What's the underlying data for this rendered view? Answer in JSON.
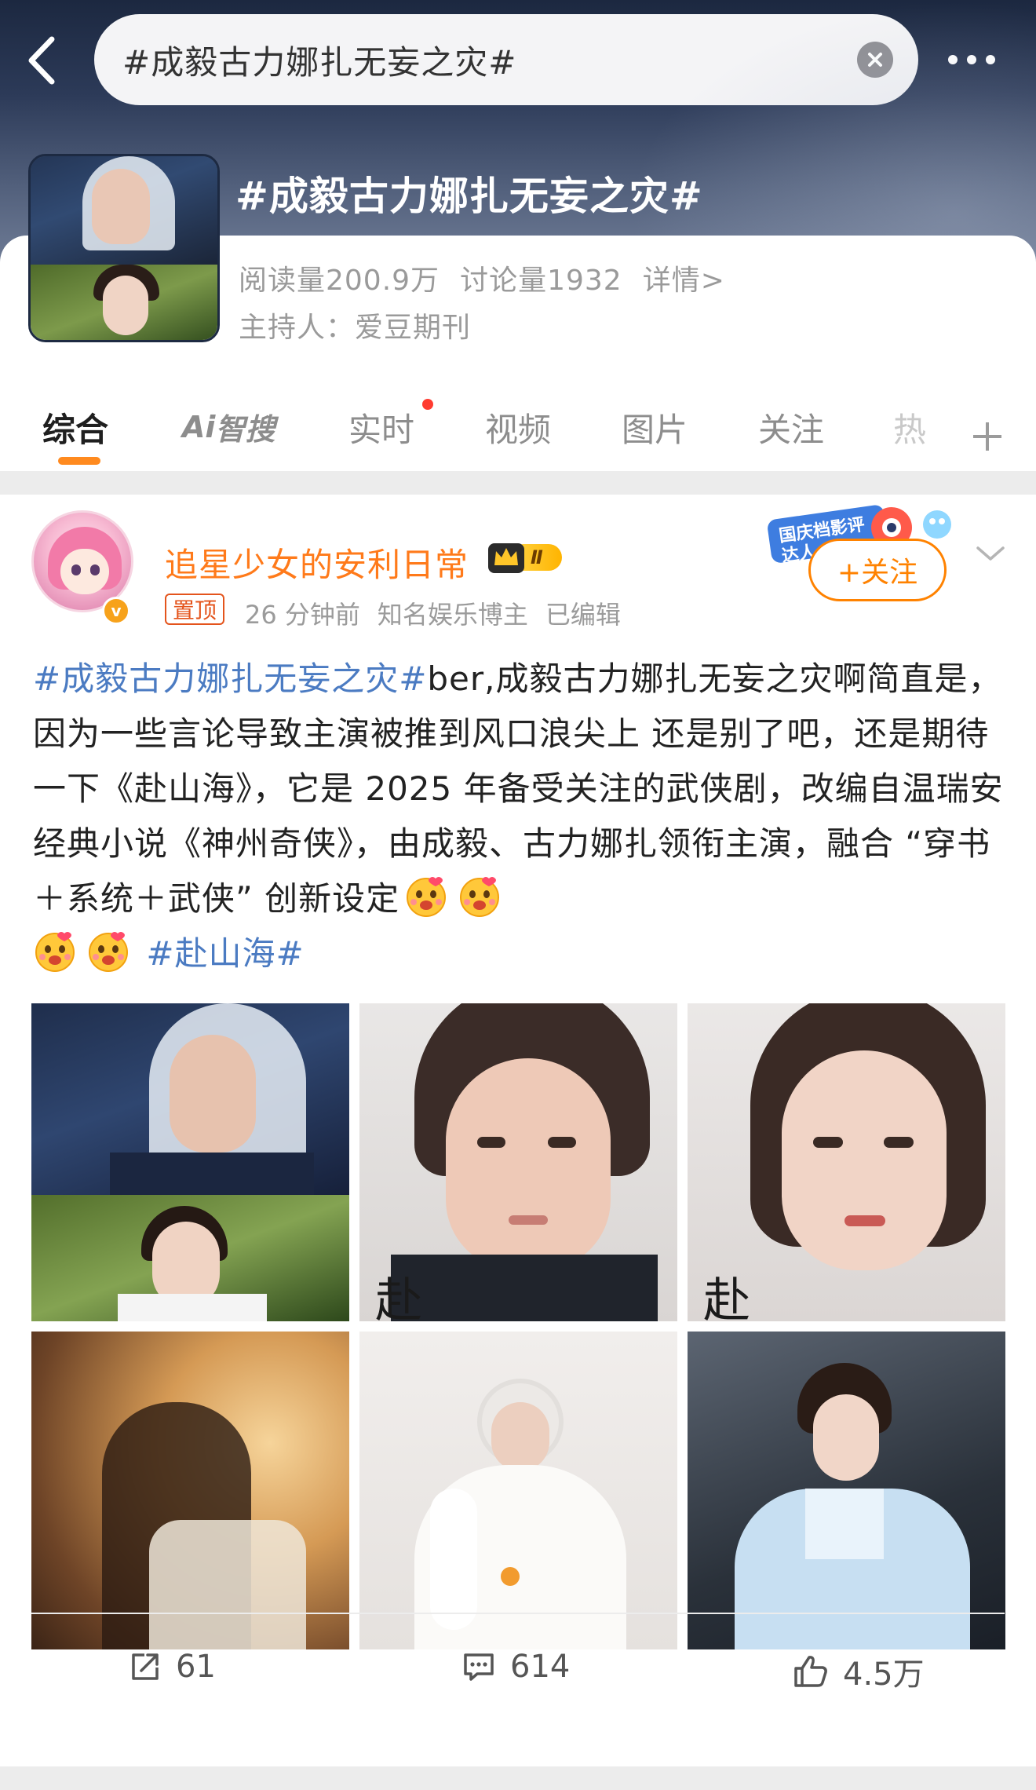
{
  "header": {
    "search_query": "#成毅古力娜扎无妄之灾#",
    "topic_title": "#成毅古力娜扎无妄之灾#",
    "reads": "阅读量200.9万",
    "discussions": "讨论量1932",
    "detail": "详情>",
    "host": "主持人：爱豆期刊"
  },
  "tabs": [
    {
      "label": "综合"
    },
    {
      "label": "智搜",
      "prefix": "Ai"
    },
    {
      "label": "实时"
    },
    {
      "label": "视频"
    },
    {
      "label": "图片"
    },
    {
      "label": "关注"
    },
    {
      "label": "热"
    }
  ],
  "post": {
    "author": "追星少女的安利日常",
    "level": "Ⅱ",
    "pin_label": "置顶",
    "time": "26 分钟前",
    "author_desc": "知名娱乐博主",
    "edited": "已编辑",
    "follow_label": "+关注",
    "event_badge": "国庆档影评达人",
    "text_hashtag": "#成毅古力娜扎无妄之灾#",
    "text_body": "ber,成毅古力娜扎无妄之灾啊简直是，因为一些言论导致主演被推到风口浪尖上 还是别了吧，还是期待一下《赴山海》，它是 2025 年备受关注的武侠剧，改编自温瑞安经典小说《神州奇侠》，由成毅、古力娜扎领衔主演，融合 “穿书＋系统＋武侠” 创新设定",
    "text_hashtag2": "#赴山海#",
    "images": [
      {
        "name": "poster-chengyi-gulinazha"
      },
      {
        "name": "poster-chengyi-closeup"
      },
      {
        "name": "poster-gulinazha-closeup"
      },
      {
        "name": "poster-backlit-swordsman"
      },
      {
        "name": "still-white-robe"
      },
      {
        "name": "still-blue-dress"
      }
    ],
    "shares": "61",
    "comments": "614",
    "likes": "4.5万"
  },
  "colors": {
    "accent": "#ff8200",
    "author": "#ff7a1a",
    "hashtag": "#4b7bc2",
    "tab_indicator": "#ff8a1f"
  }
}
